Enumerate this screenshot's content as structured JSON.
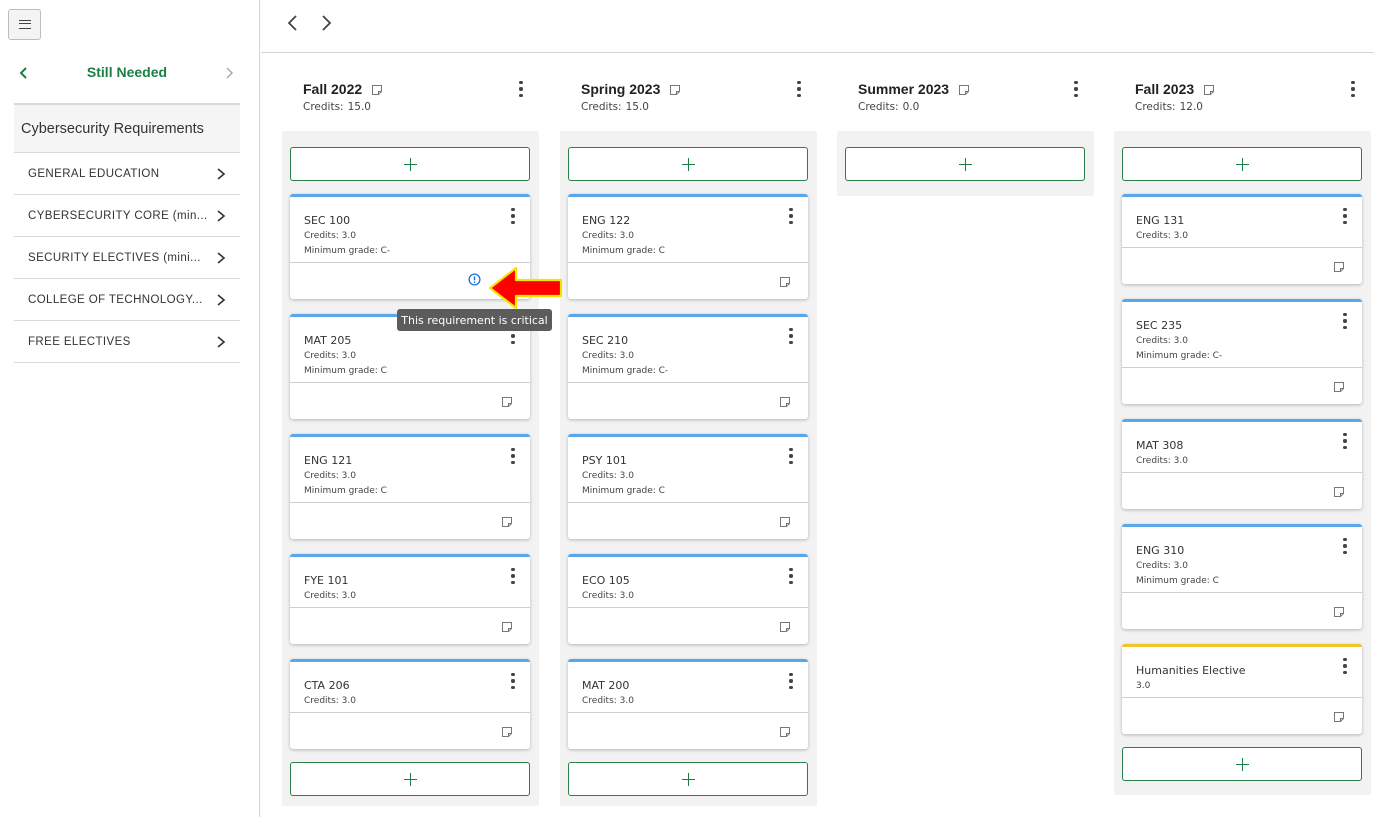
{
  "sidebar": {
    "menu_icon": "hamburger-icon",
    "still_needed_title": "Still Needed",
    "requirements_header": "Cybersecurity Requirements",
    "items": [
      {
        "label": "GENERAL EDUCATION"
      },
      {
        "label": "CYBERSECURITY CORE (min..."
      },
      {
        "label": "SECURITY ELECTIVES (mini..."
      },
      {
        "label": "COLLEGE OF TECHNOLOGY..."
      },
      {
        "label": "FREE ELECTIVES"
      }
    ]
  },
  "terms": [
    {
      "name": "Fall 2022",
      "credits_label": "Credits:",
      "credits": "15.0",
      "courses": [
        {
          "code": "SEC 100",
          "credits": "Credits: 3.0",
          "grade": "Minimum grade: C-",
          "critical": true
        },
        {
          "code": "MAT 205",
          "credits": "Credits: 3.0",
          "grade": "Minimum grade: C"
        },
        {
          "code": "ENG 121",
          "credits": "Credits: 3.0",
          "grade": "Minimum grade: C"
        },
        {
          "code": "FYE 101",
          "credits": "Credits: 3.0",
          "grade": ""
        },
        {
          "code": "CTA 206",
          "credits": "Credits: 3.0",
          "grade": ""
        }
      ]
    },
    {
      "name": "Spring 2023",
      "credits_label": "Credits:",
      "credits": "15.0",
      "courses": [
        {
          "code": "ENG 122",
          "credits": "Credits: 3.0",
          "grade": "Minimum grade: C"
        },
        {
          "code": "SEC 210",
          "credits": "Credits: 3.0",
          "grade": "Minimum grade: C-"
        },
        {
          "code": "PSY 101",
          "credits": "Credits: 3.0",
          "grade": "Minimum grade: C"
        },
        {
          "code": "ECO 105",
          "credits": "Credits: 3.0",
          "grade": ""
        },
        {
          "code": "MAT 200",
          "credits": "Credits: 3.0",
          "grade": ""
        }
      ]
    },
    {
      "name": "Summer 2023",
      "credits_label": "Credits:",
      "credits": "0.0",
      "courses": []
    },
    {
      "name": "Fall 2023",
      "credits_label": "Credits:",
      "credits": "12.0",
      "courses": [
        {
          "code": "ENG 131",
          "credits": "Credits: 3.0",
          "grade": ""
        },
        {
          "code": "SEC 235",
          "credits": "Credits: 3.0",
          "grade": "Minimum grade: C-"
        },
        {
          "code": "MAT 308",
          "credits": "Credits: 3.0",
          "grade": ""
        },
        {
          "code": "ENG 310",
          "credits": "Credits: 3.0",
          "grade": "Minimum grade: C"
        },
        {
          "code": "Humanities Elective",
          "credits": "3.0",
          "grade": ""
        }
      ]
    }
  ],
  "tooltip": {
    "text": "This requirement is critical"
  },
  "colors": {
    "accent_green": "#1a7f45",
    "card_top_blue": "#59a6e9",
    "elective_yellow": "#f0c52a",
    "annotation_arrow": "#ff0000"
  }
}
